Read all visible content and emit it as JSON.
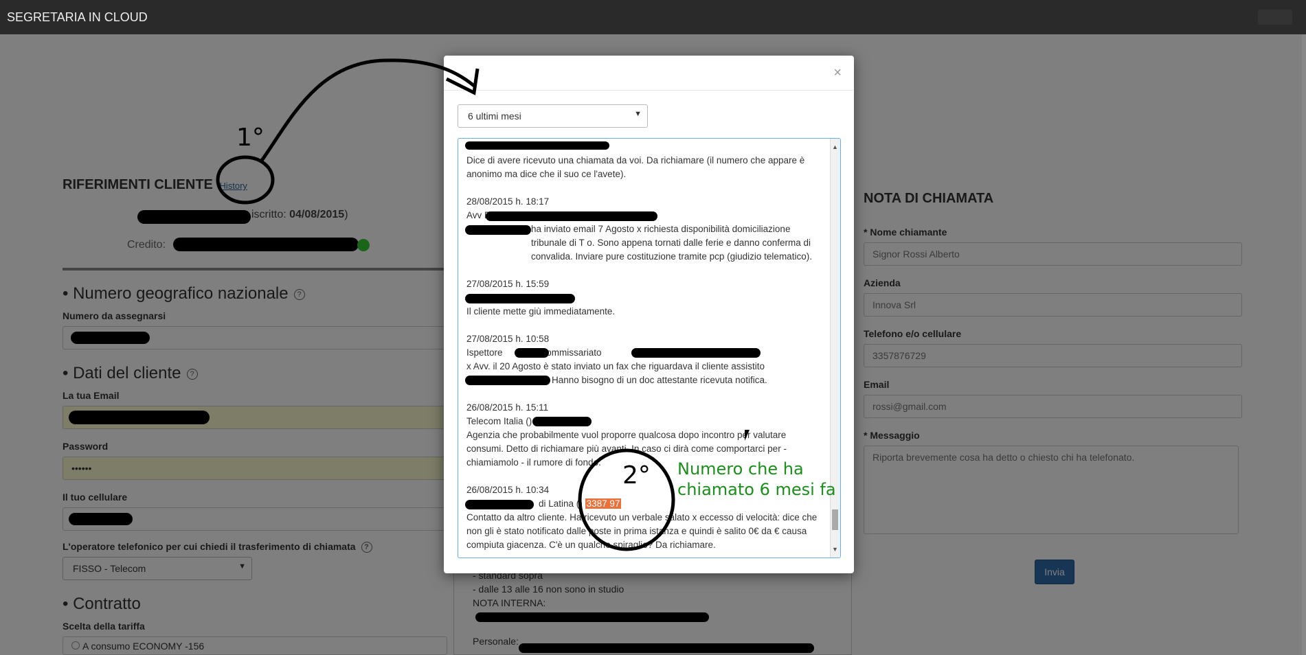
{
  "app": {
    "title": "SEGRETARIA IN CLOUD"
  },
  "left": {
    "heading": "RIFERIMENTI CLIENTE",
    "history_link": "History",
    "subscribed_label": "iscritto:",
    "subscribed_date": "04/08/2015",
    "credit_label": "Credito:",
    "credit_suffix": "€",
    "section_geo": "Numero geografico nazionale",
    "numero_label": "Numero da assegnarsi",
    "section_cliente": "Dati del cliente",
    "email_label": "La tua Email",
    "password_label": "Password",
    "password_value": "••••••",
    "cellulare_label": "Il tuo cellulare",
    "operatore_label": "L'operatore telefonico per cui chiedi il trasferimento di chiamata",
    "operatore_value": "FISSO - Telecom",
    "section_contratto": "Contratto",
    "tariffa_label": "Scelta della tariffa",
    "tariffa_option": "A consumo ECONOMY -156"
  },
  "middle_bg": {
    "lines": [
      "- standard sopra",
      "- dalle 13 alle 16 non sono in studio",
      "NOTA INTERNA:",
      "Personale:"
    ]
  },
  "right": {
    "heading": "NOTA DI CHIAMATA",
    "nome_label": "* Nome chiamante",
    "nome_placeholder": "Signor Rossi Alberto",
    "azienda_label": "Azienda",
    "azienda_placeholder": "Innova Srl",
    "telefono_label": "Telefono e/o cellulare",
    "telefono_placeholder": "3357876729",
    "email_label": "Email",
    "email_placeholder": "rossi@gmail.com",
    "messaggio_label": "* Messaggio",
    "messaggio_placeholder": "Riporta brevemente cosa ha detto o chiesto chi ha telefonato.",
    "submit": "Invia"
  },
  "modal": {
    "close": "×",
    "period_select": "6 ultimi mesi",
    "entries": {
      "e0_text": "Dice di avere ricevuto una chiamata da voi. Da richiamare (il numero che appare è anonimo ma dice che il suo ce l'avete).",
      "e1_date": "28/08/2015 h. 18:17",
      "e1_name": "Avv E",
      "e1_text": "ha inviato email 7 Agosto x richiesta disponibilità domiciliazione tribunale di T        o. Sono appena tornati dalle ferie e danno conferma di convalida. Inviare pure costituzione tramite pcp (giudizio telematico).",
      "e2_date": "27/08/2015 h. 15:59",
      "e2_text": "Il cliente mette giù immediatamente.",
      "e3_date": "27/08/2015 h. 10:58",
      "e3_name": "Ispettore",
      "e3_mid": "ommissariato",
      "e3_text": "x Avv.         il 20 Agosto è stato inviato un fax che riguardava il cliente assistito",
      "e3_text2": "Hanno bisogno di un doc attestante ricevuta notifica.",
      "e4_date": "26/08/2015 h. 15:11",
      "e4_name": "Telecom Italia ()",
      "e4_text": "Agenzia che probabilmente vuol proporre qualcosa dopo incontro per valutare consumi. Detto di richiamare più avanti. In caso ci dirà come comportarci per - chiamiamolo - il rumore di fondo.",
      "e5_date": "26/08/2015 h. 10:34",
      "e5_name": "di Latina ()",
      "e5_number": "3387    97",
      "e5_text": "Contatto da altro cliente. Ha ricevuto un verbale salato x eccesso di velocità: dice che non gli è stato notificato dalle poste in prima istanza e quindi è salito      0€ da     € causa compiuta giacenza. C'è un qualche spiraglio? Da richiamare."
    }
  },
  "annotations": {
    "first": "1°",
    "second": "2°",
    "note_line1": "Numero che ha",
    "note_line2": "chiamato 6 mesi fa"
  }
}
